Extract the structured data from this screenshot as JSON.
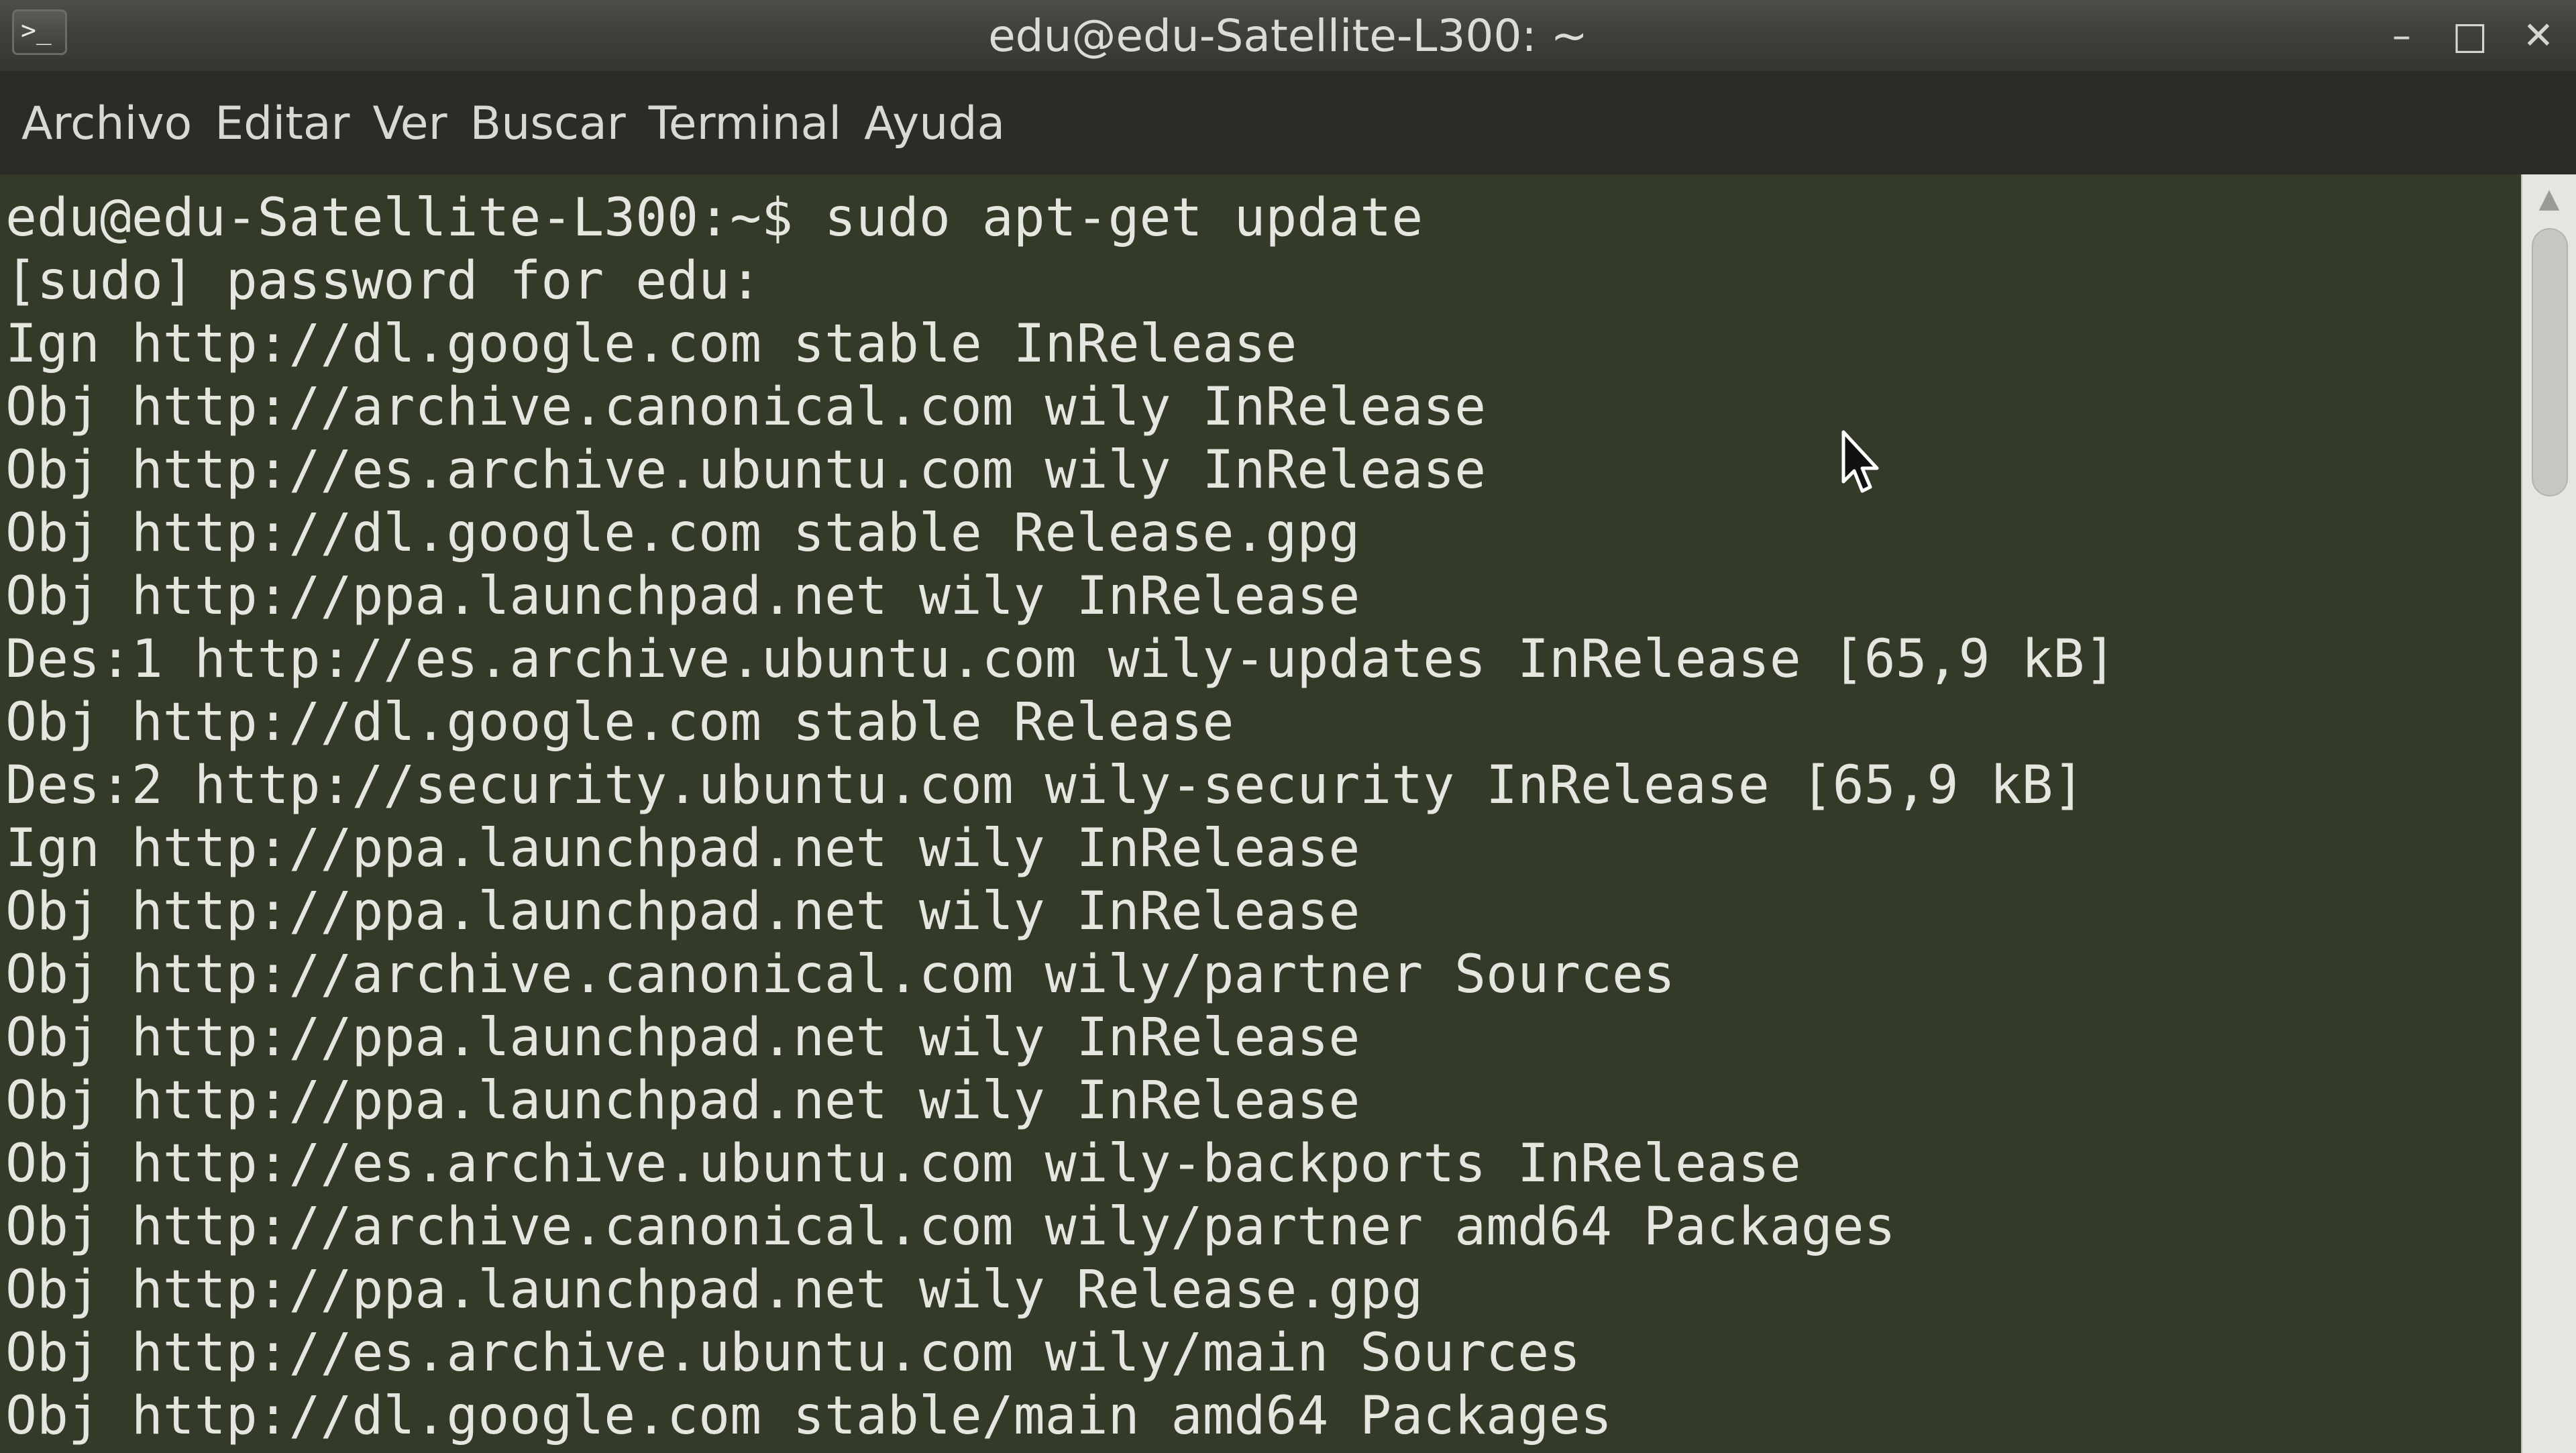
{
  "window": {
    "icon_glyph": ">_",
    "title": "edu@edu-Satellite-L300: ~",
    "controls": {
      "minimize": "–",
      "maximize": "□",
      "close": "✕"
    }
  },
  "menubar": {
    "items": [
      "Archivo",
      "Editar",
      "Ver",
      "Buscar",
      "Terminal",
      "Ayuda"
    ]
  },
  "terminal": {
    "lines": [
      "edu@edu-Satellite-L300:~$ sudo apt-get update",
      "[sudo] password for edu:",
      "Ign http://dl.google.com stable InRelease",
      "Obj http://archive.canonical.com wily InRelease",
      "Obj http://es.archive.ubuntu.com wily InRelease",
      "Obj http://dl.google.com stable Release.gpg",
      "Obj http://ppa.launchpad.net wily InRelease",
      "Des:1 http://es.archive.ubuntu.com wily-updates InRelease [65,9 kB]",
      "Obj http://dl.google.com stable Release",
      "Des:2 http://security.ubuntu.com wily-security InRelease [65,9 kB]",
      "Ign http://ppa.launchpad.net wily InRelease",
      "Obj http://ppa.launchpad.net wily InRelease",
      "Obj http://archive.canonical.com wily/partner Sources",
      "Obj http://ppa.launchpad.net wily InRelease",
      "Obj http://ppa.launchpad.net wily InRelease",
      "Obj http://es.archive.ubuntu.com wily-backports InRelease",
      "Obj http://archive.canonical.com wily/partner amd64 Packages",
      "Obj http://ppa.launchpad.net wily Release.gpg",
      "Obj http://es.archive.ubuntu.com wily/main Sources",
      "Obj http://dl.google.com stable/main amd64 Packages"
    ]
  },
  "icons": {
    "app": "terminal-icon",
    "minimize": "minimize-icon",
    "maximize": "maximize-icon",
    "close": "close-icon",
    "scroll_up": "chevron-up-icon",
    "pointer": "mouse-pointer-icon"
  },
  "colors": {
    "terminal_background": "#333a27",
    "terminal_text": "#e6e6e1",
    "titlebar": "#3f403b",
    "menubar": "#2b2c28"
  }
}
